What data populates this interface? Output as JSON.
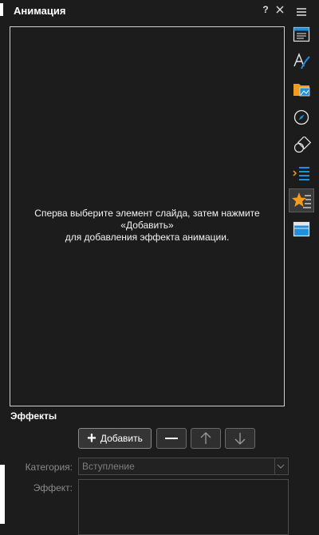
{
  "panel": {
    "title": "Анимация",
    "help": "?",
    "hint_line1": "Сперва выберите элемент слайда, затем нажмите «Добавить»",
    "hint_line2": "для добавления эффекта анимации."
  },
  "effects": {
    "section_label": "Эффекты",
    "add_label": "Добавить",
    "category_label": "Категория:",
    "category_value": "Вступление",
    "effect_label": "Эффект:"
  },
  "sidebar": {
    "items": [
      {
        "icon": "menu-icon"
      },
      {
        "icon": "properties-icon"
      },
      {
        "icon": "styles-icon"
      },
      {
        "icon": "gallery-icon"
      },
      {
        "icon": "navigator-icon"
      },
      {
        "icon": "shapes-icon"
      },
      {
        "icon": "slide-transition-icon"
      },
      {
        "icon": "animation-icon",
        "active": true
      },
      {
        "icon": "master-slides-icon"
      }
    ]
  },
  "colors": {
    "background": "#1c1c1c",
    "accent_blue": "#1e90e0",
    "accent_orange": "#f29b1d"
  }
}
